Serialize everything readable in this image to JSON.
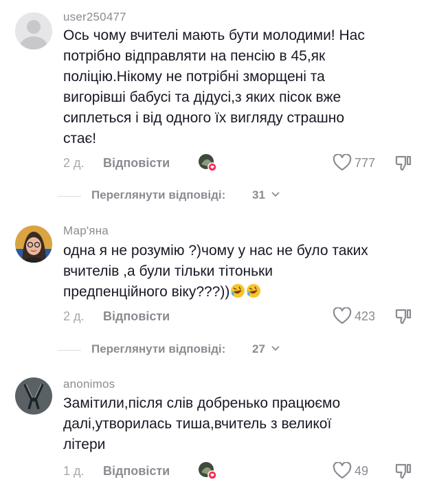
{
  "comments": [
    {
      "username": "user250477",
      "lines": [
        "Ось чому вчителі мають бути молодими! Нас",
        "потрібно відправляти на пенсію в 45,як",
        "поліцію.Нікому не потрібні зморщені та",
        "вигорівші бабусі та дідусі,з яких пісок вже",
        "сиплеться і від одного їх вигляду страшно",
        "стає!"
      ],
      "date": "2 д.",
      "reply_label": "Відповісти",
      "likes": "777",
      "view_replies_label": "Переглянути відповіді:",
      "view_replies_count": "31"
    },
    {
      "username": "Мар'яна",
      "lines": [
        "одна я не розумію ?)чому у нас не було таких",
        "вчителів ,а були тільки тітоньки",
        "предпенційного віку???))"
      ],
      "date": "2 д.",
      "reply_label": "Відповісти",
      "likes": "423",
      "view_replies_label": "Переглянути відповіді:",
      "view_replies_count": "27"
    },
    {
      "username": "anonimos",
      "lines": [
        "Замітили,після слів добренько працюємо",
        "далі,утворилась тиша,вчитель з великої",
        "літери"
      ],
      "date": "1 д.",
      "reply_label": "Відповісти",
      "likes": "49"
    }
  ],
  "colors": {
    "secondary_text": "#8a8b91",
    "like_heart": "#fe2c55"
  },
  "icons": [
    "heart-outline-icon",
    "dislike-icon",
    "chevron-down-icon",
    "rofl-emoji-icon"
  ]
}
